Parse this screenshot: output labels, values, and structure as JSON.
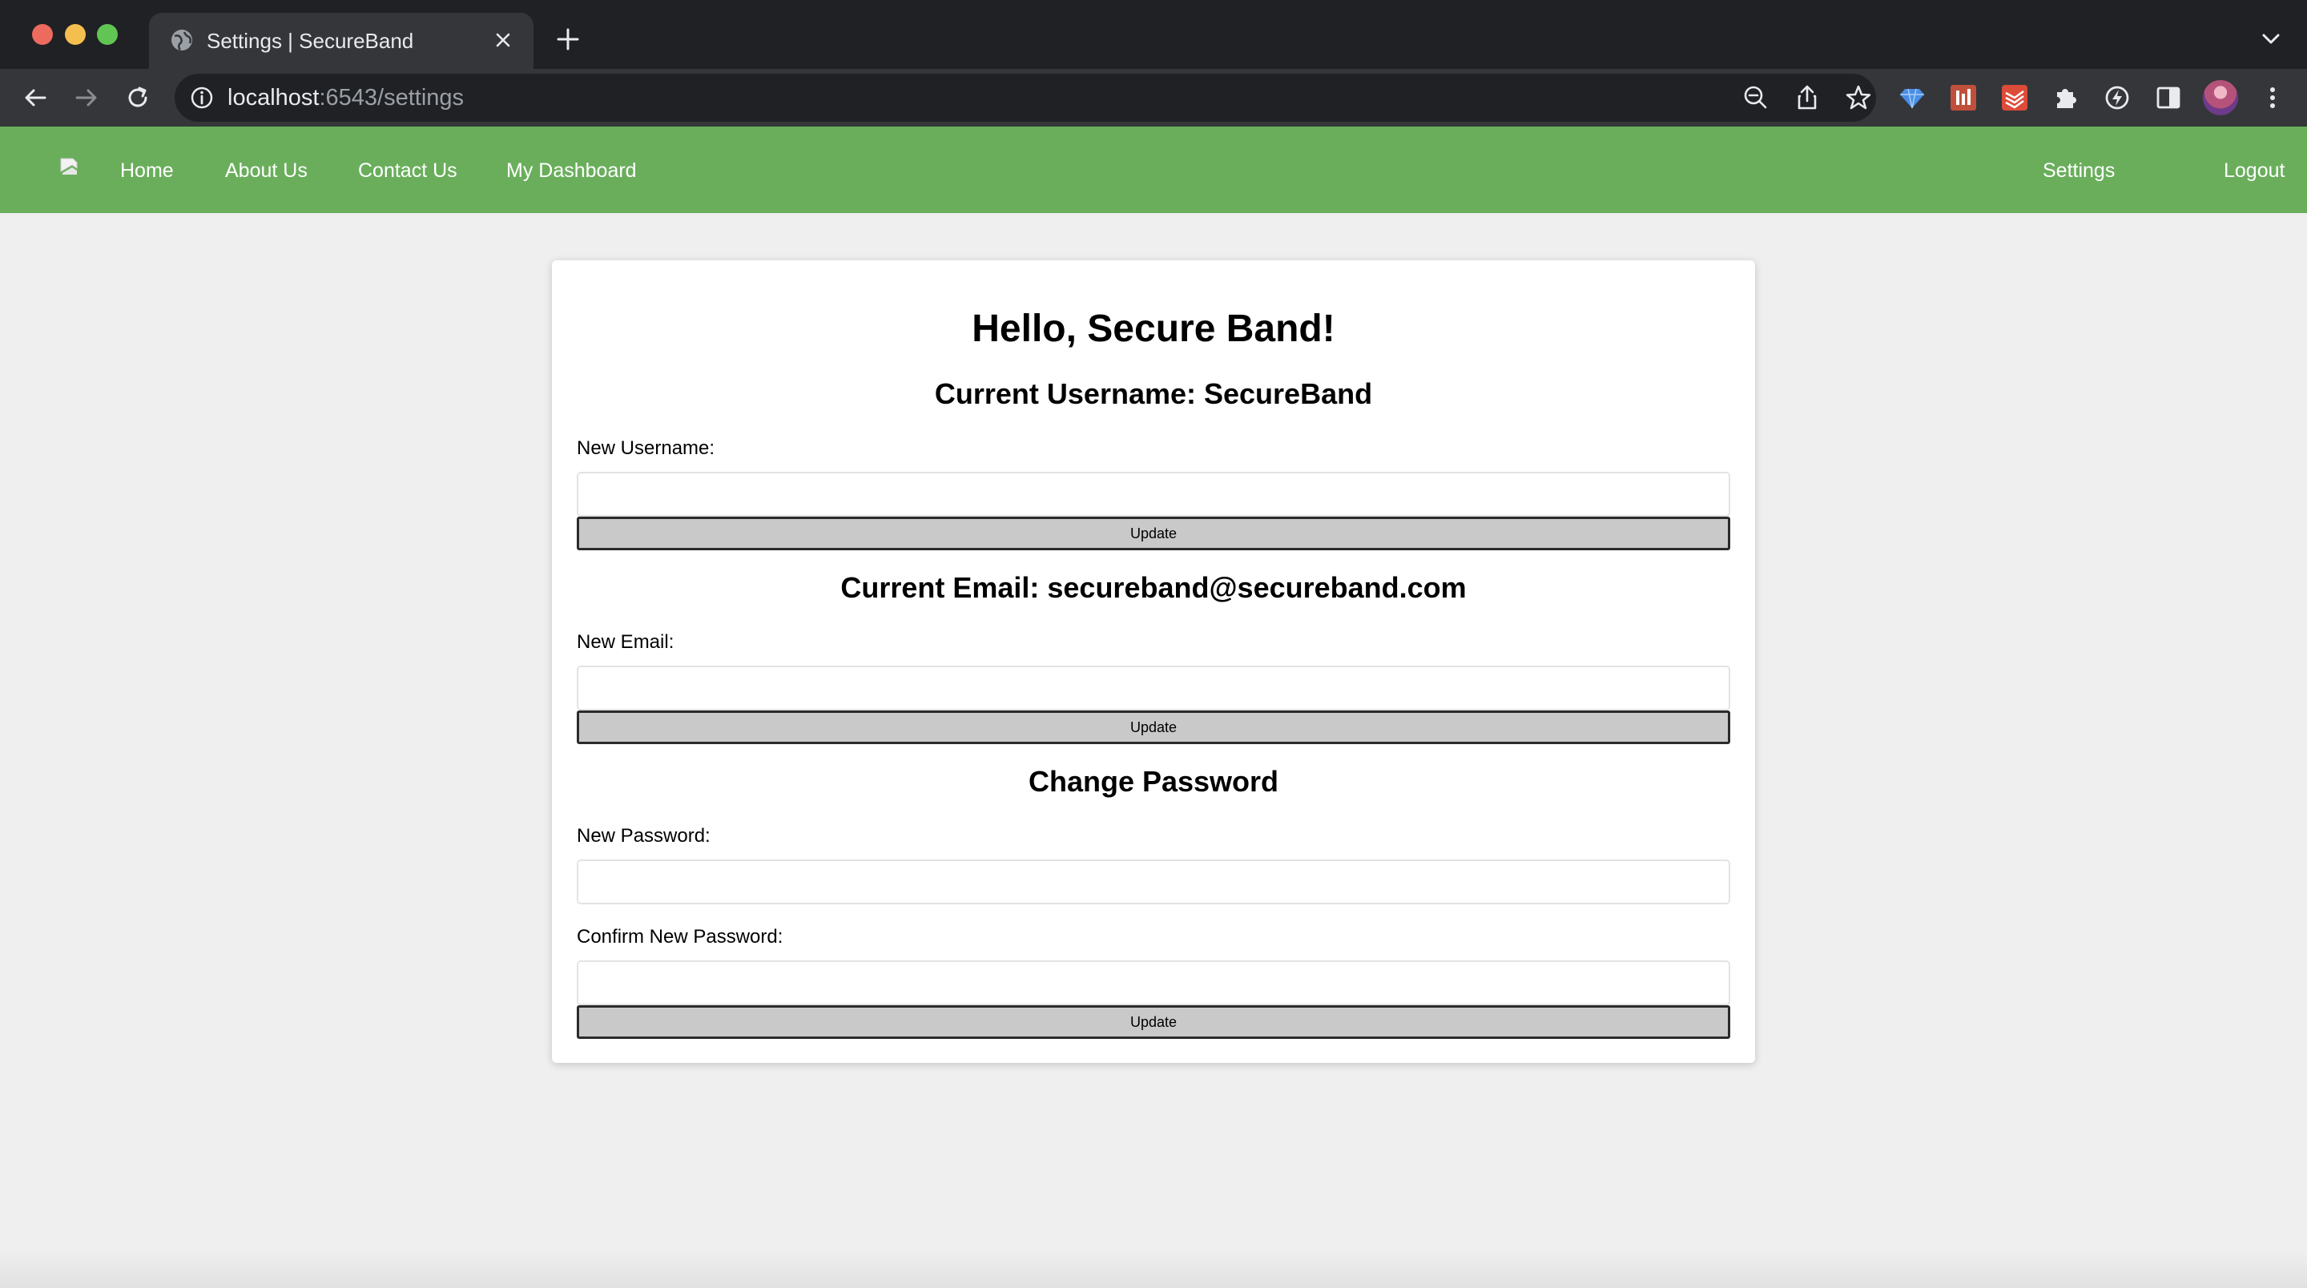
{
  "browser": {
    "tab_title": "Settings | SecureBand",
    "url_host": "localhost",
    "url_rest": ":6543/settings"
  },
  "nav": {
    "home": "Home",
    "about": "About Us",
    "contact": "Contact Us",
    "dashboard": "My Dashboard",
    "settings": "Settings",
    "logout": "Logout"
  },
  "settings": {
    "greeting": "Hello, Secure Band!",
    "current_username": "Current Username: SecureBand",
    "new_username_label": "New Username:",
    "new_username_value": "",
    "update_label": "Update",
    "current_email": "Current Email: secureband@secureband.com",
    "new_email_label": "New Email:",
    "new_email_value": "",
    "change_password_heading": "Change Password",
    "new_password_label": "New Password:",
    "new_password_value": "",
    "confirm_password_label": "Confirm New Password:",
    "confirm_password_value": ""
  },
  "colors": {
    "nav_green": "#6aae5c",
    "page_bg": "#efefef",
    "button_gray": "#c9c9c9",
    "chrome_dark": "#202124"
  }
}
